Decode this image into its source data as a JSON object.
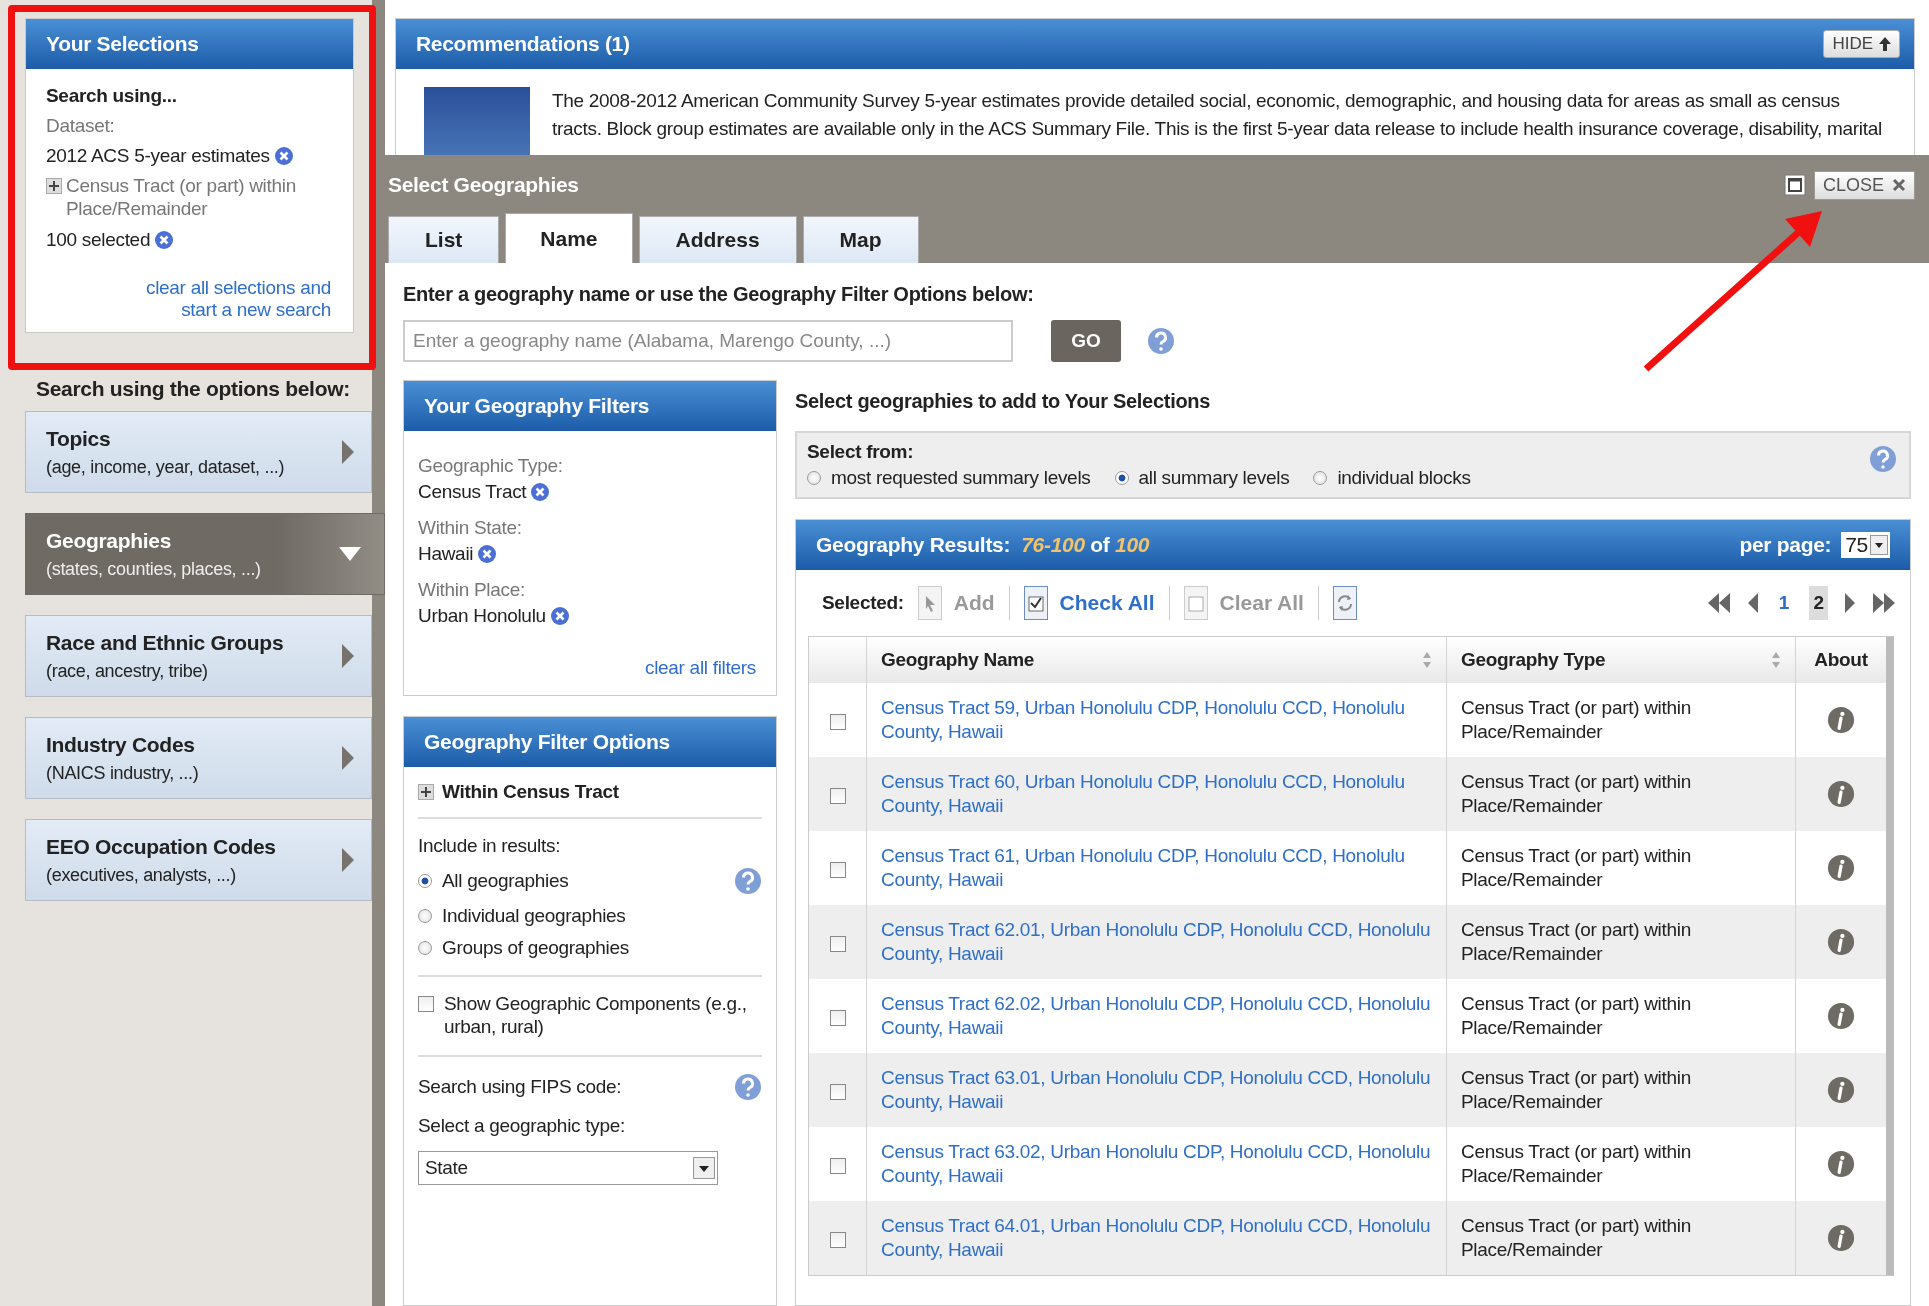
{
  "selections": {
    "title": "Your Selections",
    "heading": "Search using...",
    "dataset_label": "Dataset:",
    "dataset_value": "2012 ACS 5-year estimates",
    "geo_type": "Census Tract (or part) within Place/Remainder",
    "geo_count": "100 selected",
    "clear_link": "clear all selections and start a new search"
  },
  "options_heading": "Search using the options below:",
  "sidebar_items": [
    {
      "title": "Topics",
      "subtitle": "(age, income, year, dataset, ...)",
      "selected": false
    },
    {
      "title": "Geographies",
      "subtitle": "(states, counties, places, ...)",
      "selected": true
    },
    {
      "title": "Race and Ethnic Groups",
      "subtitle": "(race, ancestry, tribe)",
      "selected": false
    },
    {
      "title": "Industry Codes",
      "subtitle": "(NAICS industry, ...)",
      "selected": false
    },
    {
      "title": "EEO Occupation Codes",
      "subtitle": "(executives, analysts, ...)",
      "selected": false
    }
  ],
  "recommendations": {
    "title": "Recommendations (1)",
    "hide_button": "HIDE",
    "text": "The 2008-2012 American Community Survey 5-year estimates provide detailed social, economic, demographic, and housing data for areas as small as census tracts. Block group estimates are available only in the ACS Summary File. This is the first 5-year data release to include health insurance coverage, disability, marital"
  },
  "dialog": {
    "title": "Select Geographies",
    "close_button": "CLOSE",
    "tabs": [
      {
        "label": "List",
        "selected": false
      },
      {
        "label": "Name",
        "selected": true
      },
      {
        "label": "Address",
        "selected": false
      },
      {
        "label": "Map",
        "selected": false
      }
    ],
    "prompt": "Enter a geography name or use the Geography Filter Options below:",
    "search_placeholder": "Enter a geography name (Alabama, Marengo County, ...)",
    "go_button": "GO"
  },
  "filters": {
    "title": "Your Geography Filters",
    "items": [
      {
        "label": "Geographic Type:",
        "value": "Census Tract"
      },
      {
        "label": "Within State:",
        "value": "Hawaii"
      },
      {
        "label": "Within Place:",
        "value": "Urban Honolulu"
      }
    ],
    "clear_link": "clear all filters"
  },
  "filter_options": {
    "title": "Geography Filter Options",
    "section": "Within Census Tract",
    "include_label": "Include in results:",
    "include_options": [
      {
        "label": "All geographies",
        "selected": true
      },
      {
        "label": "Individual geographies",
        "selected": false
      },
      {
        "label": "Groups of geographies",
        "selected": false
      }
    ],
    "components": {
      "label": "Show Geographic Components (e.g., urban, rural)",
      "checked": false
    },
    "fips_label": "Search using FIPS code:",
    "type_label": "Select a geographic type:",
    "type_value": "State"
  },
  "results": {
    "heading": "Select geographies to add to Your Selections",
    "select_from_label": "Select from:",
    "select_from_options": [
      {
        "label": "most requested summary levels",
        "selected": false
      },
      {
        "label": "all summary levels",
        "selected": true
      },
      {
        "label": "individual blocks",
        "selected": false
      }
    ],
    "title": "Geography Results:",
    "range": "76-100",
    "of": "of",
    "total": "100",
    "per_page_label": "per page:",
    "per_page": "75",
    "selected_label": "Selected:",
    "actions": [
      {
        "kind": "add",
        "label": "Add",
        "disabled": true
      },
      {
        "kind": "check",
        "label": "Check All",
        "disabled": false
      },
      {
        "kind": "clear",
        "label": "Clear All",
        "disabled": true
      }
    ],
    "pages": [
      {
        "label": "1",
        "selected": false
      },
      {
        "label": "2",
        "selected": true
      }
    ],
    "columns": [
      "Geography Name",
      "Geography Type",
      "About"
    ],
    "rows": [
      {
        "name": "Census Tract 59, Urban Honolulu CDP, Honolulu CCD, Honolulu County, Hawaii",
        "type": "Census Tract (or part) within Place/Remainder",
        "checked": false
      },
      {
        "name": "Census Tract 60, Urban Honolulu CDP, Honolulu CCD, Honolulu County, Hawaii",
        "type": "Census Tract (or part) within Place/Remainder",
        "checked": false
      },
      {
        "name": "Census Tract 61, Urban Honolulu CDP, Honolulu CCD, Honolulu County, Hawaii",
        "type": "Census Tract (or part) within Place/Remainder",
        "checked": false
      },
      {
        "name": "Census Tract 62.01, Urban Honolulu CDP, Honolulu CCD, Honolulu County, Hawaii",
        "type": "Census Tract (or part) within Place/Remainder",
        "checked": false
      },
      {
        "name": "Census Tract 62.02, Urban Honolulu CDP, Honolulu CCD, Honolulu County, Hawaii",
        "type": "Census Tract (or part) within Place/Remainder",
        "checked": false
      },
      {
        "name": "Census Tract 63.01, Urban Honolulu CDP, Honolulu CCD, Honolulu County, Hawaii",
        "type": "Census Tract (or part) within Place/Remainder",
        "checked": false
      },
      {
        "name": "Census Tract 63.02, Urban Honolulu CDP, Honolulu CCD, Honolulu County, Hawaii",
        "type": "Census Tract (or part) within Place/Remainder",
        "checked": false
      },
      {
        "name": "Census Tract 64.01, Urban Honolulu CDP, Honolulu CCD, Honolulu County, Hawaii",
        "type": "Census Tract (or part) within Place/Remainder",
        "checked": false
      }
    ]
  }
}
